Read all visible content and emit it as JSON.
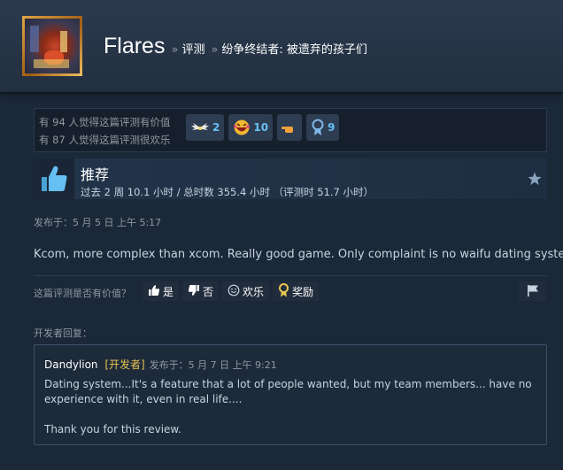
{
  "header": {
    "profile_name": "Flares",
    "breadcrumb_sep": "»",
    "breadcrumb_reviews": "评测",
    "breadcrumb_game": "纷争终结者: 被遗弃的孩子们"
  },
  "stats": {
    "helpful_line": "有 94 人觉得这篇评测有价值",
    "funny_line": "有 87 人觉得这篇评测很欢乐",
    "awards": [
      {
        "icon": "wings-award-icon",
        "count": "2"
      },
      {
        "icon": "laughing-face-award-icon",
        "count": "10"
      },
      {
        "icon": "finger-pointing-award-icon",
        "count": ""
      },
      {
        "icon": "medal-award-icon",
        "count": "9"
      }
    ]
  },
  "recommendation": {
    "title": "推荐",
    "hours": "过去 2 周 10.1 小时 / 总时数 355.4 小时 （评测时 51.7 小时）"
  },
  "posted": "发布于：5 月 5 日 上午 5:17",
  "review_text": "Kcom, more complex than xcom. Really good game. Only complaint is no waifu dating system.",
  "helpful_prompt": {
    "label": "这篇评测是否有价值？",
    "yes": "是",
    "no": "否",
    "funny": "欢乐",
    "award": "奖励"
  },
  "developer_response": {
    "label": "开发者回复：",
    "name": "Dandylion",
    "tag": "[开发者]",
    "date": "发布于：5 月 7 日 上午 9:21",
    "line1": "Dating system...It's a feature that a lot of people wanted, but my team members... have no experience with it, even in real life....",
    "line2": "Thank you for this review."
  },
  "colors": {
    "background": "#1b2838",
    "accent_blue": "#66c0f4",
    "developer_tag": "#e8c550"
  }
}
